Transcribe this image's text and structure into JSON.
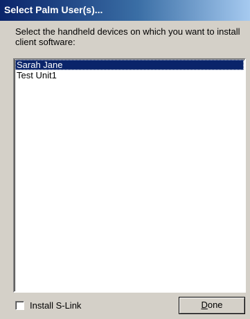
{
  "window": {
    "title": "Select Palm User(s)..."
  },
  "instruction": "Select the handheld devices on which you want to install client software:",
  "devices": [
    {
      "label": "Sarah Jane",
      "selected": true
    },
    {
      "label": "Test Unit1",
      "selected": false
    }
  ],
  "install_slink": {
    "label": "Install S-Link",
    "checked": false
  },
  "done_button": {
    "mnemonic": "D",
    "rest": "one"
  },
  "colors": {
    "selection": "#0a246a",
    "dialog_face": "#d4d0c8",
    "title_gradient_start": "#0a246a",
    "title_gradient_end": "#a6caf0"
  }
}
